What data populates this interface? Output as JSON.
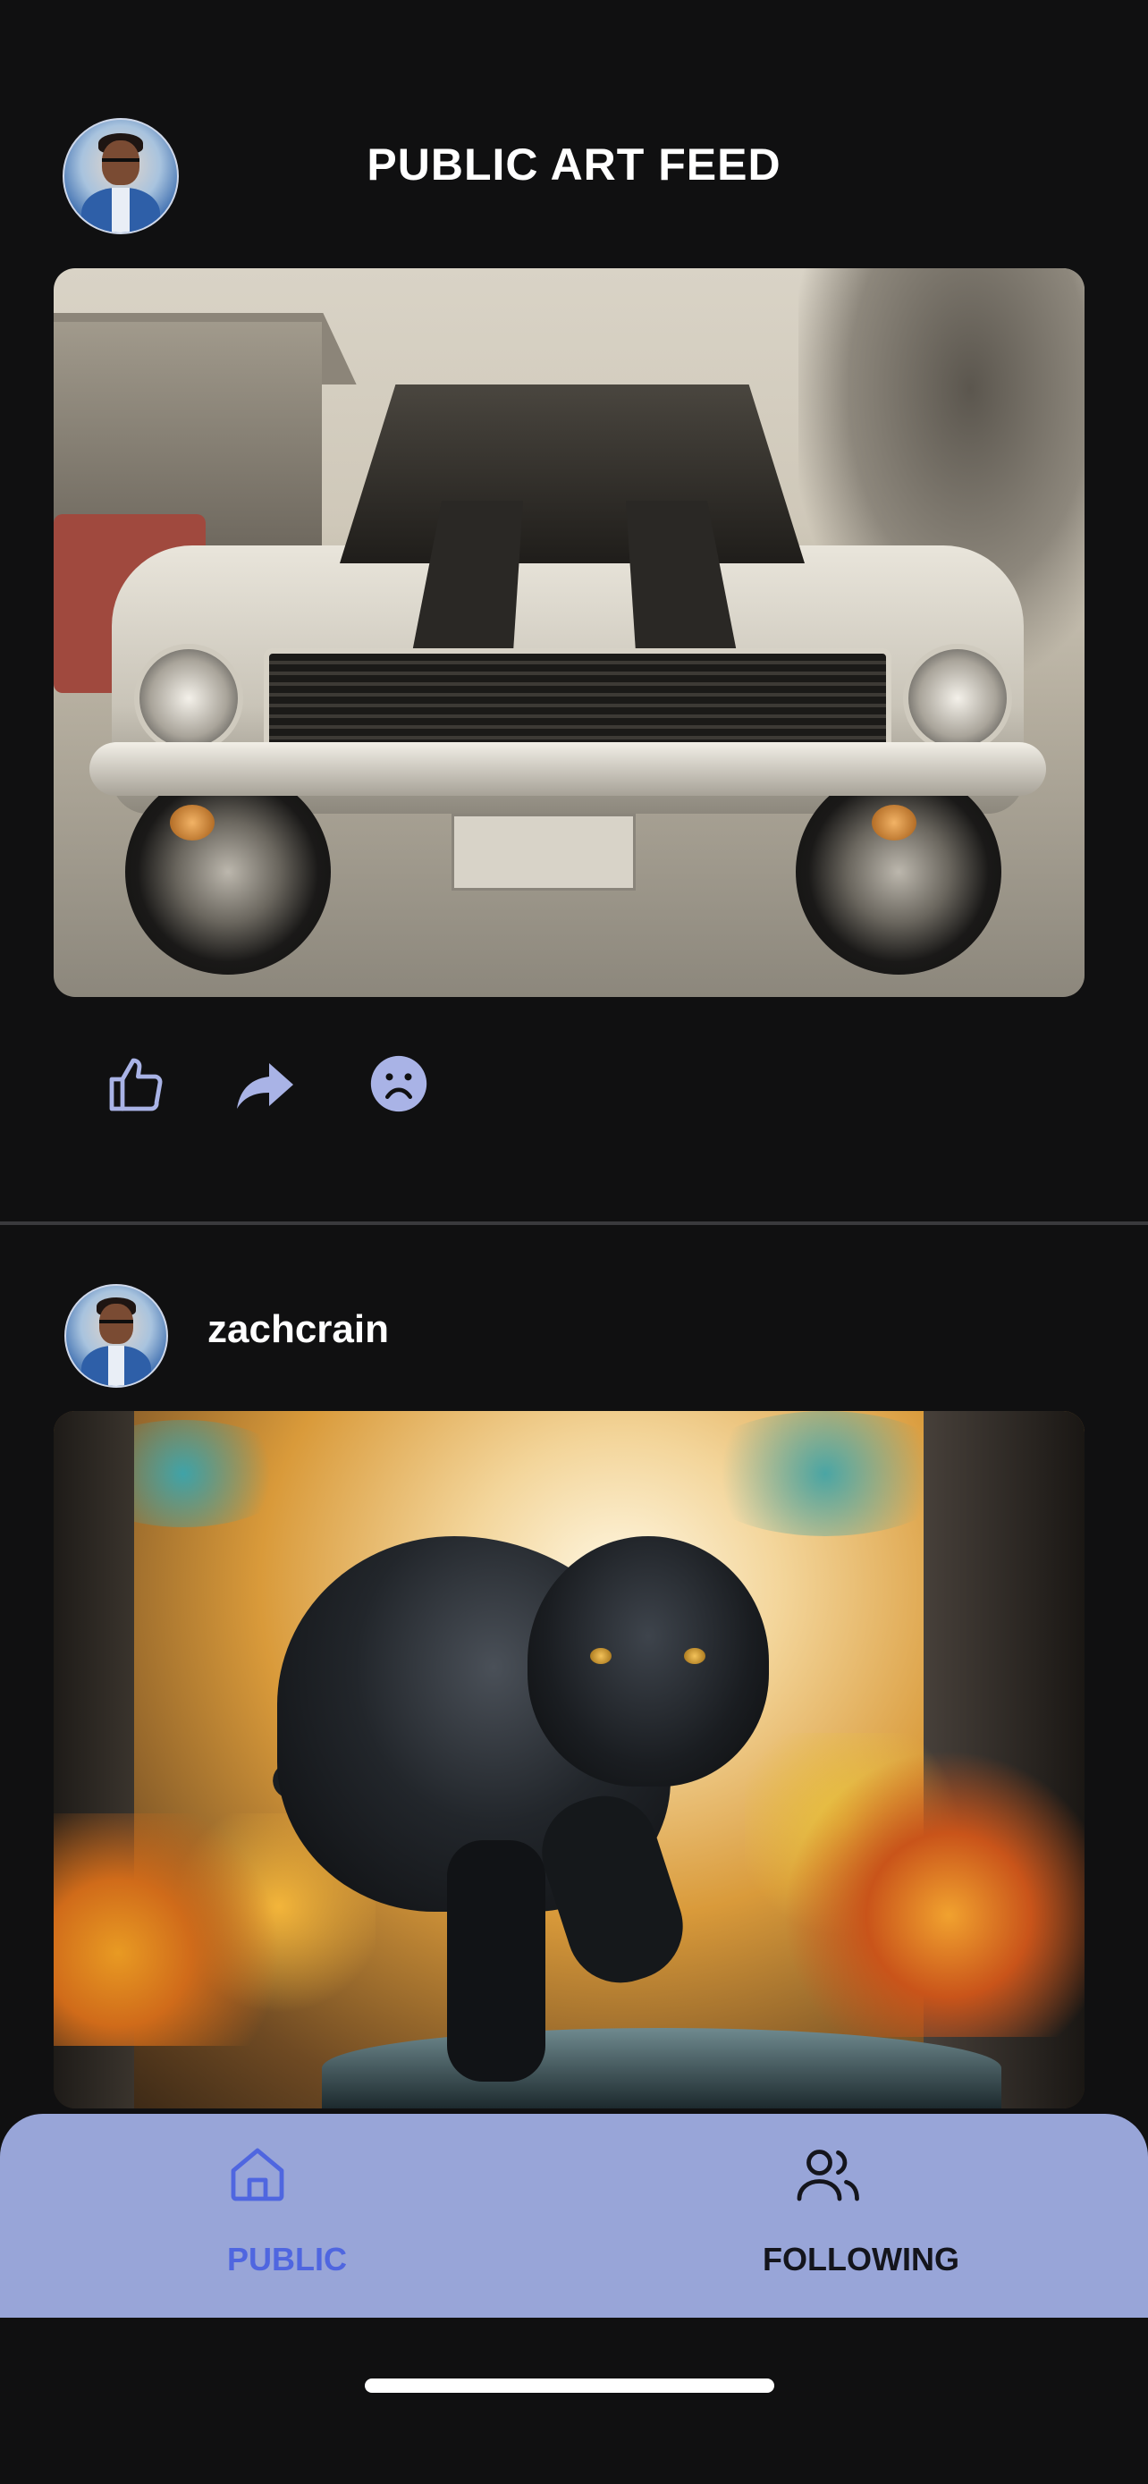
{
  "header": {
    "title": "PUBLIC ART FEED"
  },
  "posts": [
    {
      "username": "",
      "image_alt": "pencil sketch of a classic muscle car",
      "actions": {
        "like_icon": "thumbs-up-icon",
        "share_icon": "share-arrow-icon",
        "dislike_icon": "sad-face-icon"
      }
    },
    {
      "username": "zachcrain",
      "image_alt": "painting of a black panther walking through an autumn forest"
    }
  ],
  "tabbar": {
    "tabs": [
      {
        "label": "PUBLIC",
        "icon": "home-icon",
        "active": true
      },
      {
        "label": "FOLLOWING",
        "icon": "users-icon",
        "active": false
      }
    ]
  },
  "colors": {
    "background": "#101011",
    "tabbar": "#98a5d8",
    "active_tab": "#4f66e0",
    "icon": "#a9b3e6"
  }
}
